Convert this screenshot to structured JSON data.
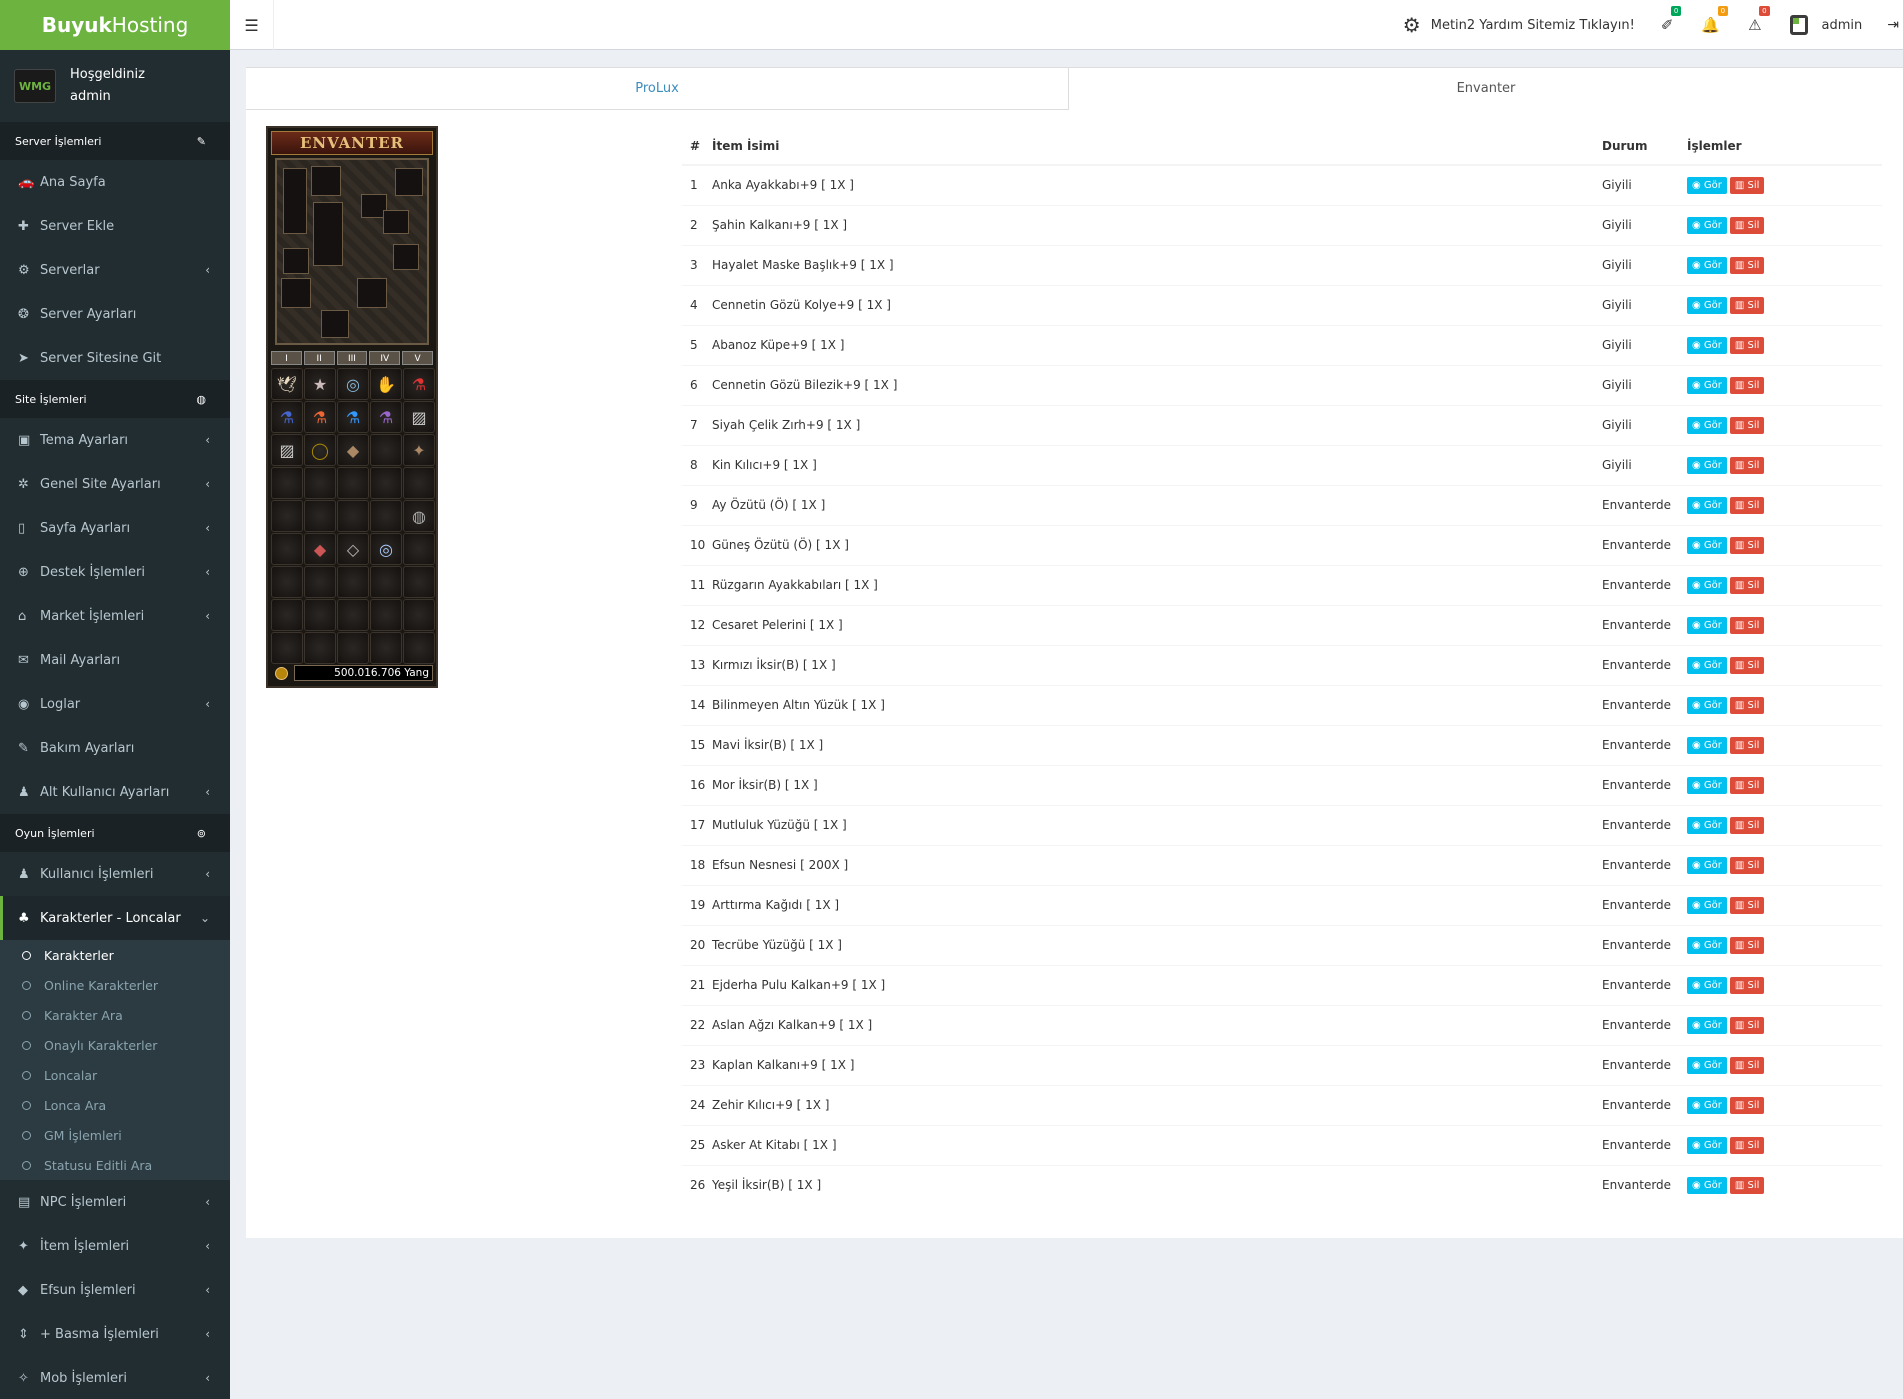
{
  "brand": {
    "bold": "Buyuk",
    "light": "Hosting"
  },
  "user_panel": {
    "avatar_text": "WMG",
    "greeting": "Hoşgeldiniz",
    "username": "admin"
  },
  "sidebar": {
    "sections": [
      {
        "title": "Server İşlemleri",
        "items": [
          {
            "label": "Ana Sayfa",
            "icon": "🚗",
            "chev": false
          },
          {
            "label": "Server Ekle",
            "icon": "✚",
            "chev": false
          },
          {
            "label": "Serverlar",
            "icon": "⚙",
            "chev": true
          },
          {
            "label": "Server Ayarları",
            "icon": "❂",
            "chev": false
          },
          {
            "label": "Server Sitesine Git",
            "icon": "➤",
            "chev": false
          }
        ]
      },
      {
        "title": "Site İşlemleri",
        "items": [
          {
            "label": "Tema Ayarları",
            "icon": "▣",
            "chev": true
          },
          {
            "label": "Genel Site Ayarları",
            "icon": "✲",
            "chev": true
          },
          {
            "label": "Sayfa Ayarları",
            "icon": "▯",
            "chev": true
          },
          {
            "label": "Destek İşlemleri",
            "icon": "⊕",
            "chev": true
          },
          {
            "label": "Market İşlemleri",
            "icon": "⌂",
            "chev": true
          },
          {
            "label": "Mail Ayarları",
            "icon": "✉",
            "chev": false
          },
          {
            "label": "Loglar",
            "icon": "◉",
            "chev": true
          },
          {
            "label": "Bakım Ayarları",
            "icon": "✎",
            "chev": false
          },
          {
            "label": "Alt Kullanıcı Ayarları",
            "icon": "♟",
            "chev": true
          }
        ]
      },
      {
        "title": "Oyun İşlemleri",
        "items": [
          {
            "label": "Kullanıcı İşlemleri",
            "icon": "♟",
            "chev": true
          },
          {
            "label": "Karakterler - Loncalar",
            "icon": "♣",
            "chev": true,
            "active": true
          }
        ]
      }
    ],
    "submenu": [
      "Karakterler",
      "Online Karakterler",
      "Karakter Ara",
      "Onaylı Karakterler",
      "Loncalar",
      "Lonca Ara",
      "GM İşlemleri",
      "Statusu Editli Ara"
    ],
    "submenu_current": 0,
    "after_items": [
      {
        "label": "NPC İşlemleri",
        "icon": "▤",
        "chev": true
      },
      {
        "label": "İtem İşlemleri",
        "icon": "✦",
        "chev": true
      },
      {
        "label": "Efsun İşlemleri",
        "icon": "◆",
        "chev": true
      },
      {
        "label": "+ Basma İşlemleri",
        "icon": "⇕",
        "chev": true
      },
      {
        "label": "Mob İşlemleri",
        "icon": "✧",
        "chev": true
      }
    ]
  },
  "header": {
    "help_link": "Metin2 Yardım Sitemiz Tıklayın!",
    "badges": [
      "0",
      "0",
      "0"
    ],
    "admin_name": "admin"
  },
  "tabs": [
    "ProLux",
    "Envanter"
  ],
  "inventory": {
    "title": "ENVANTER",
    "pages": [
      "I",
      "II",
      "III",
      "IV",
      "V"
    ],
    "yang": "500.016.706 Yang"
  },
  "table": {
    "headers": [
      "#",
      "İtem İsimi",
      "Durum",
      "İşlemler"
    ],
    "view_label": "Gör",
    "delete_label": "Sil",
    "rows": [
      [
        "1",
        "Anka Ayakkabı+9 [ 1X ]",
        "Giyili"
      ],
      [
        "2",
        "Şahin Kalkanı+9 [ 1X ]",
        "Giyili"
      ],
      [
        "3",
        "Hayalet Maske Başlık+9 [ 1X ]",
        "Giyili"
      ],
      [
        "4",
        "Cennetin Gözü Kolye+9 [ 1X ]",
        "Giyili"
      ],
      [
        "5",
        "Abanoz Küpe+9 [ 1X ]",
        "Giyili"
      ],
      [
        "6",
        "Cennetin Gözü Bilezik+9 [ 1X ]",
        "Giyili"
      ],
      [
        "7",
        "Siyah Çelik Zırh+9 [ 1X ]",
        "Giyili"
      ],
      [
        "8",
        "Kin Kılıcı+9 [ 1X ]",
        "Giyili"
      ],
      [
        "9",
        "Ay Özütü (Ö) [ 1X ]",
        "Envanterde"
      ],
      [
        "10",
        "Güneş Özütü (Ö) [ 1X ]",
        "Envanterde"
      ],
      [
        "11",
        "Rüzgarın Ayakkabıları [ 1X ]",
        "Envanterde"
      ],
      [
        "12",
        "Cesaret Pelerini [ 1X ]",
        "Envanterde"
      ],
      [
        "13",
        "Kırmızı İksir(B) [ 1X ]",
        "Envanterde"
      ],
      [
        "14",
        "Bilinmeyen Altın Yüzük [ 1X ]",
        "Envanterde"
      ],
      [
        "15",
        "Mavi İksir(B) [ 1X ]",
        "Envanterde"
      ],
      [
        "16",
        "Mor İksir(B) [ 1X ]",
        "Envanterde"
      ],
      [
        "17",
        "Mutluluk Yüzüğü [ 1X ]",
        "Envanterde"
      ],
      [
        "18",
        "Efsun Nesnesi [ 200X ]",
        "Envanterde"
      ],
      [
        "19",
        "Arttırma Kağıdı [ 1X ]",
        "Envanterde"
      ],
      [
        "20",
        "Tecrübe Yüzüğü [ 1X ]",
        "Envanterde"
      ],
      [
        "21",
        "Ejderha Pulu Kalkan+9 [ 1X ]",
        "Envanterde"
      ],
      [
        "22",
        "Aslan Ağzı Kalkan+9 [ 1X ]",
        "Envanterde"
      ],
      [
        "23",
        "Kaplan Kalkanı+9 [ 1X ]",
        "Envanterde"
      ],
      [
        "24",
        "Zehir Kılıcı+9 [ 1X ]",
        "Envanterde"
      ],
      [
        "25",
        "Asker At Kitabı [ 1X ]",
        "Envanterde"
      ],
      [
        "26",
        "Yeşil İksir(B) [ 1X ]",
        "Envanterde"
      ]
    ]
  }
}
